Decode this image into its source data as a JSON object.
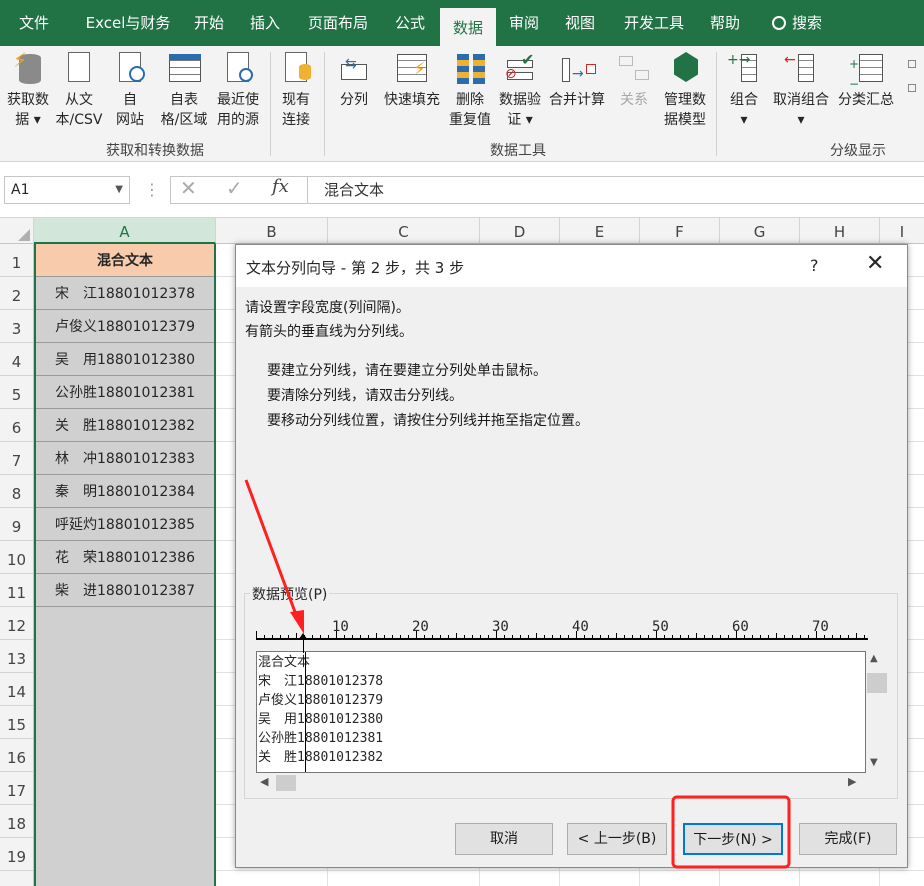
{
  "tabs": [
    "文件",
    "Excel与财务",
    "开始",
    "插入",
    "页面布局",
    "公式",
    "数据",
    "审阅",
    "视图",
    "开发工具",
    "帮助",
    "搜索"
  ],
  "ribbon": {
    "get_data": {
      "line1": "获取数",
      "line2": "据"
    },
    "from_csv": {
      "line1": "从文",
      "line2": "本/CSV"
    },
    "from_web": {
      "line1": "自",
      "line2": "网站"
    },
    "from_table": {
      "line1": "自表",
      "line2": "格/区域"
    },
    "recent": {
      "line1": "最近使",
      "line2": "用的源"
    },
    "existing": {
      "line1": "现有",
      "line2": "连接"
    },
    "group1": "获取和转换数据",
    "split": "分列",
    "flash_fill": "快速填充",
    "remove_dup": {
      "line1": "删除",
      "line2": "重复值"
    },
    "validate": {
      "line1": "数据验",
      "line2": "证"
    },
    "consolidate": "合并计算",
    "relations": "关系",
    "data_model": {
      "line1": "管理数",
      "line2": "据模型"
    },
    "group2": "数据工具",
    "group_btn": "组合",
    "ungroup_btn": "取消组合",
    "subtotal": "分类汇总",
    "group3": "分级显示"
  },
  "formula_bar": {
    "name_box": "A1",
    "content": "混合文本"
  },
  "columns": [
    "A",
    "B",
    "C",
    "D",
    "E",
    "F",
    "G",
    "H",
    "I"
  ],
  "rows": [
    "1",
    "2",
    "3",
    "4",
    "5",
    "6",
    "7",
    "8",
    "9",
    "10",
    "11",
    "12",
    "13",
    "14",
    "15",
    "16",
    "17",
    "18",
    "19"
  ],
  "cells_a": [
    "混合文本",
    "宋　江18801012378",
    "卢俊义18801012379",
    "吴　用18801012380",
    "公孙胜18801012381",
    "关　胜18801012382",
    "林　冲18801012383",
    "秦　明18801012384",
    "呼延灼18801012385",
    "花　荣18801012386",
    "柴　进18801012387"
  ],
  "dialog": {
    "title": "文本分列向导 - 第 2 步，共 3 步",
    "help": "?",
    "line1": "请设置字段宽度(列间隔)。",
    "line2": "有箭头的垂直线为分列线。",
    "inst1": "要建立分列线，请在要建立分列处单击鼠标。",
    "inst2": "要清除分列线，请双击分列线。",
    "inst3": "要移动分列线位置，请按住分列线并拖至指定位置。",
    "preview_label": "数据预览(P)",
    "ruler_numbers": [
      "10",
      "20",
      "30",
      "40",
      "50",
      "60",
      "70"
    ],
    "preview_lines": [
      "混合文本",
      "宋　江18801012378",
      "卢俊义18801012379",
      "吴　用18801012380",
      "公孙胜18801012381",
      "关　胜18801012382"
    ],
    "cancel": "取消",
    "back": "< 上一步(B)",
    "next": "下一步(N) >",
    "finish": "完成(F)"
  },
  "colors": {
    "excel_green": "#217346",
    "highlight_red": "#ff2020",
    "header_fill": "#f8cbad"
  }
}
